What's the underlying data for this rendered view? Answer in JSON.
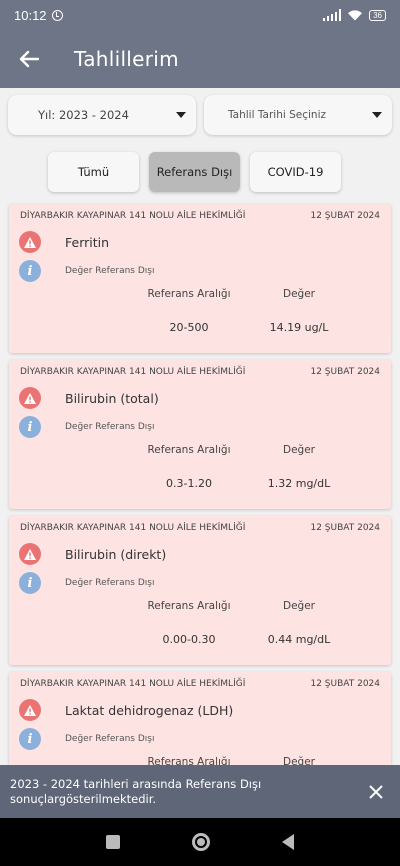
{
  "status_bar": {
    "time": "10:12",
    "battery": "36"
  },
  "app_bar": {
    "title": "Tahlillerim"
  },
  "filters": {
    "year_dropdown": "Yıl: 2023 - 2024",
    "date_dropdown": "Tahlil Tarihi Seçiniz"
  },
  "segments": {
    "all": "Tümü",
    "out_of_range": "Referans Dışı",
    "covid": "COVID-19"
  },
  "labels": {
    "reference_range": "Referans Aralığı",
    "value": "Değer"
  },
  "cards": [
    {
      "facility": "DİYARBAKIR KAYAPINAR 141 NOLU AİLE HEKİMLİĞİ",
      "date": "12 ŞUBAT 2024",
      "test": "Ferritin",
      "status": "Değer Referans Dışı",
      "range": "20-500",
      "value": "14.19 ug/L"
    },
    {
      "facility": "DİYARBAKIR KAYAPINAR 141 NOLU AİLE HEKİMLİĞİ",
      "date": "12 ŞUBAT 2024",
      "test": "Bilirubin (total)",
      "status": "Değer Referans Dışı",
      "range": "0.3-1.20",
      "value": "1.32 mg/dL"
    },
    {
      "facility": "DİYARBAKIR KAYAPINAR 141 NOLU AİLE HEKİMLİĞİ",
      "date": "12 ŞUBAT 2024",
      "test": "Bilirubin (direkt)",
      "status": "Değer Referans Dışı",
      "range": "0.00-0.30",
      "value": "0.44 mg/dL"
    },
    {
      "facility": "DİYARBAKIR KAYAPINAR 141 NOLU AİLE HEKİMLİĞİ",
      "date": "12 ŞUBAT 2024",
      "test": "Laktat dehidrogenaz (LDH)",
      "status": "Değer Referans Dışı",
      "range": "",
      "value": ""
    }
  ],
  "snackbar": {
    "message": "2023 - 2024 tarihleri arasında Referans Dışı sonuçlargösterilmektedir."
  },
  "icons": {
    "back": "arrow-left-icon",
    "warning": "warning-icon",
    "info": "info-icon",
    "close": "close-icon"
  },
  "colors": {
    "primary": "#6e7586",
    "card_bg": "#fde3e2",
    "warning": "#ea7373",
    "info": "#8cb0dc",
    "selected_segment": "#b9b9b9"
  }
}
